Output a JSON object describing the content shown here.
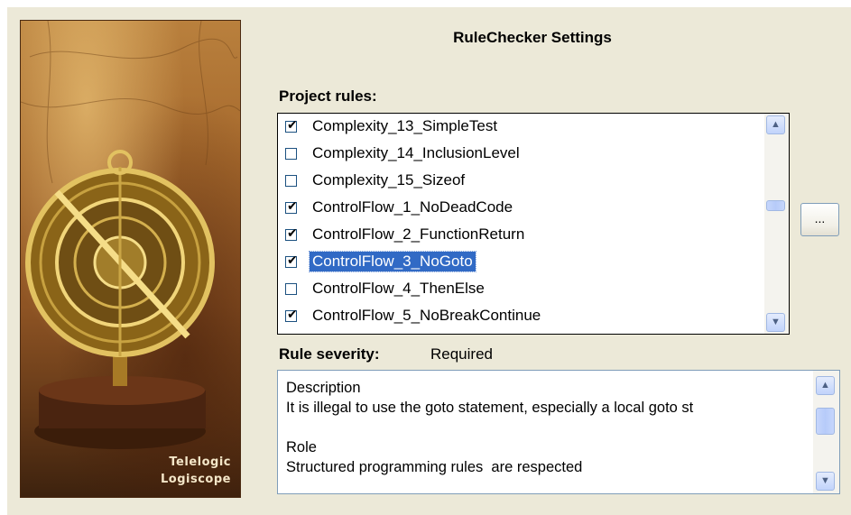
{
  "branding": {
    "line1": "Telelogic",
    "line2": "Logiscope"
  },
  "dialog": {
    "title": "RuleChecker Settings"
  },
  "project_rules": {
    "label": "Project rules:",
    "items": [
      {
        "label": "Complexity_13_SimpleTest",
        "checked": true,
        "selected": false
      },
      {
        "label": "Complexity_14_InclusionLevel",
        "checked": false,
        "selected": false
      },
      {
        "label": "Complexity_15_Sizeof",
        "checked": false,
        "selected": false
      },
      {
        "label": "ControlFlow_1_NoDeadCode",
        "checked": true,
        "selected": false
      },
      {
        "label": "ControlFlow_2_FunctionReturn",
        "checked": true,
        "selected": false
      },
      {
        "label": "ControlFlow_3_NoGoto",
        "checked": true,
        "selected": true
      },
      {
        "label": "ControlFlow_4_ThenElse",
        "checked": false,
        "selected": false
      },
      {
        "label": "ControlFlow_5_NoBreakContinue",
        "checked": true,
        "selected": false
      }
    ],
    "browse_label": "..."
  },
  "severity": {
    "label": "Rule severity:",
    "value": "Required"
  },
  "description": {
    "lines": [
      "Description",
      "It is illegal to use the goto statement, especially a local goto st",
      "",
      "Role",
      "Structured programming rules  are respected"
    ]
  },
  "icons": {
    "scroll_up": "chevron-up-icon",
    "scroll_down": "chevron-down-icon",
    "checkbox": "checkmark-icon"
  },
  "colors": {
    "dialog_bg": "#ece9d8",
    "selection": "#316ac5",
    "scrollbar_button": "#c1d3fb"
  }
}
